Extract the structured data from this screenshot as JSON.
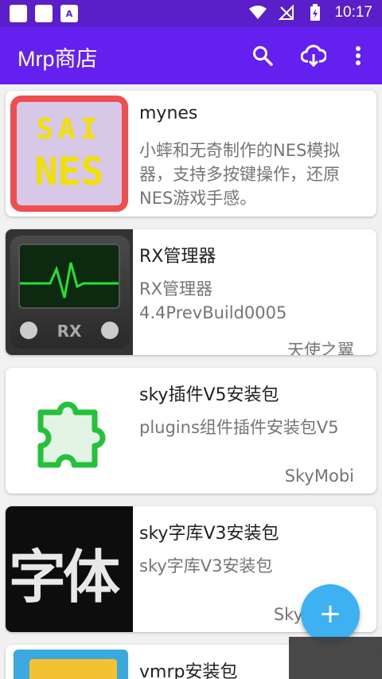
{
  "status_bar": {
    "time": "10:17",
    "notification_letter": "A",
    "icons": [
      "wifi-icon",
      "no-signal-icon",
      "battery-charging-icon"
    ]
  },
  "app_bar": {
    "title": "Mrp商店",
    "actions": [
      "search-icon",
      "download-icon",
      "more-vert-icon"
    ]
  },
  "apps": [
    {
      "title": "mynes",
      "description": "小蟀和无奇制作的NES模拟器，支持多按键操作，还原NES游戏手感。",
      "thumb_text_top": "SAI",
      "thumb_text_bottom": "NES",
      "author": ""
    },
    {
      "title": "RX管理器",
      "description": "RX管理器\n4.4PrevBuild0005",
      "thumb_text": "RX",
      "author": "天使之翼"
    },
    {
      "title": "sky插件V5安装包",
      "description": "plugins组件插件安装包V5",
      "author": "SkyMobi"
    },
    {
      "title": "sky字库V3安装包",
      "description": "sky字库V3安装包",
      "thumb_text": "字体",
      "author": "Sky"
    },
    {
      "title": "vmrp安装包",
      "description": "",
      "author": ""
    }
  ],
  "fab": {
    "label": "+"
  },
  "colors": {
    "status_bar": "#5a1fc9",
    "app_bar": "#6320ee",
    "fab": "#3db1f2"
  }
}
